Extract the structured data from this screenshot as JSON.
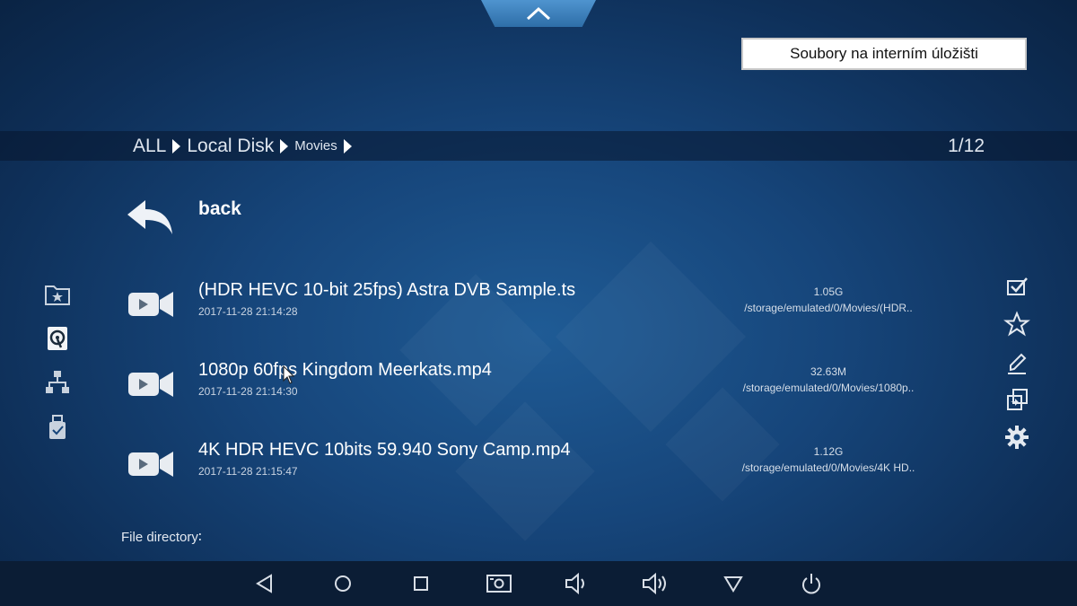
{
  "caption": "Soubory na interním úložišti",
  "breadcrumb": {
    "items": [
      {
        "label": "ALL",
        "size": "big"
      },
      {
        "label": "Local Disk",
        "size": "big"
      },
      {
        "label": "Movies",
        "size": "small"
      }
    ],
    "page_count": "1/12"
  },
  "back_label": "back",
  "files": [
    {
      "name": "(HDR HEVC 10-bit 25fps) Astra DVB Sample.ts",
      "date": "2017-11-28 21:14:28",
      "size": "1.05G",
      "path": "/storage/emulated/0/Movies/(HDR.."
    },
    {
      "name": "1080p 60fps Kingdom Meerkats.mp4",
      "date": "2017-11-28 21:14:30",
      "size": "32.63M",
      "path": "/storage/emulated/0/Movies/1080p.."
    },
    {
      "name": "4K HDR HEVC 10bits 59.940 Sony Camp.mp4",
      "date": "2017-11-28 21:15:47",
      "size": "1.12G",
      "path": "/storage/emulated/0/Movies/4K HD.."
    }
  ],
  "file_directory_label": "File directory∶",
  "icons": {
    "left_sidebar": [
      "favorite-folder-icon",
      "local-disk-icon",
      "network-icon",
      "usb-icon"
    ],
    "right_sidebar": [
      "select-checkbox-icon",
      "star-icon",
      "edit-icon",
      "copy-paste-icon",
      "settings-gear-icon"
    ],
    "nav_bar": [
      "back-triangle-icon",
      "home-circle-icon",
      "recents-square-icon",
      "screenshot-icon",
      "volume-down-icon",
      "volume-up-icon",
      "menu-down-icon",
      "power-icon"
    ]
  },
  "colors": {
    "background": "#16457a",
    "nav_bar": "#0b1d35",
    "top_tab": "#3f82bf"
  }
}
